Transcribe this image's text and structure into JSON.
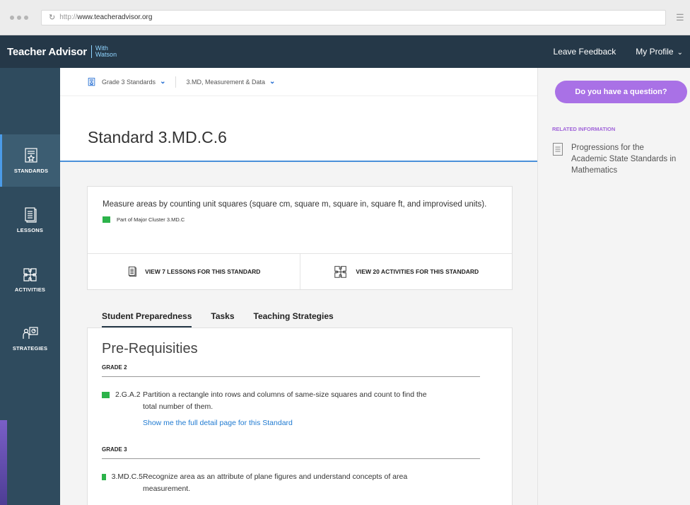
{
  "browser": {
    "url_protocol": "http://",
    "url_host": "www.teacheradvisor.org"
  },
  "header": {
    "brand": "Teacher Advisor",
    "with_label": "With",
    "watson_label": "Watson",
    "leave_feedback": "Leave Feedback",
    "my_profile": "My Profile"
  },
  "rail": {
    "items": [
      {
        "label": "STANDARDS",
        "icon": "standards-icon",
        "active": true
      },
      {
        "label": "LESSONS",
        "icon": "lessons-icon",
        "active": false
      },
      {
        "label": "ACTIVITIES",
        "icon": "activities-icon",
        "active": false
      },
      {
        "label": "STRATEGIES",
        "icon": "strategies-icon",
        "active": false
      }
    ]
  },
  "breadcrumb": {
    "grade": "Grade 3 Standards",
    "domain": "3.MD, Measurement & Data"
  },
  "page": {
    "title": "Standard 3.MD.C.6"
  },
  "standard_card": {
    "description": "Measure areas by counting unit squares (square cm, square m, square in, square ft, and improvised units).",
    "cluster": "Part of Major Cluster 3.MD.C",
    "cluster_color": "#2cb34a",
    "view_lessons": "VIEW 7 LESSONS FOR THIS STANDARD",
    "view_activities": "VIEW 20 ACTIVITIES FOR THIS STANDARD"
  },
  "tabs": [
    {
      "label": "Student Preparedness",
      "active": true
    },
    {
      "label": "Tasks",
      "active": false
    },
    {
      "label": "Teaching Strategies",
      "active": false
    }
  ],
  "prereq": {
    "title": "Pre-Requisities",
    "grade2": {
      "heading": "GRADE 2",
      "code": "2.G.A.2",
      "text": "Partition a rectangle into rows and columns of same-size squares and count to find the total number of them.",
      "link": "Show me the full detail page for this Standard"
    },
    "grade3": {
      "heading": "GRADE 3",
      "code": "3.MD.C.5",
      "text": "Recognize area as an attribute of plane figures and understand concepts of area measurement."
    }
  },
  "side": {
    "ask_button": "Do you have a question?",
    "related_heading": "RELATED INFORMATION",
    "related_item": "Progressions for the Academic State Standards in Mathematics"
  },
  "colors": {
    "header_bg": "#253848",
    "rail_bg": "#2f4b5e",
    "accent_blue": "#4a90d9",
    "ask_purple": "#a971e6",
    "link_blue": "#1f7ad1"
  }
}
